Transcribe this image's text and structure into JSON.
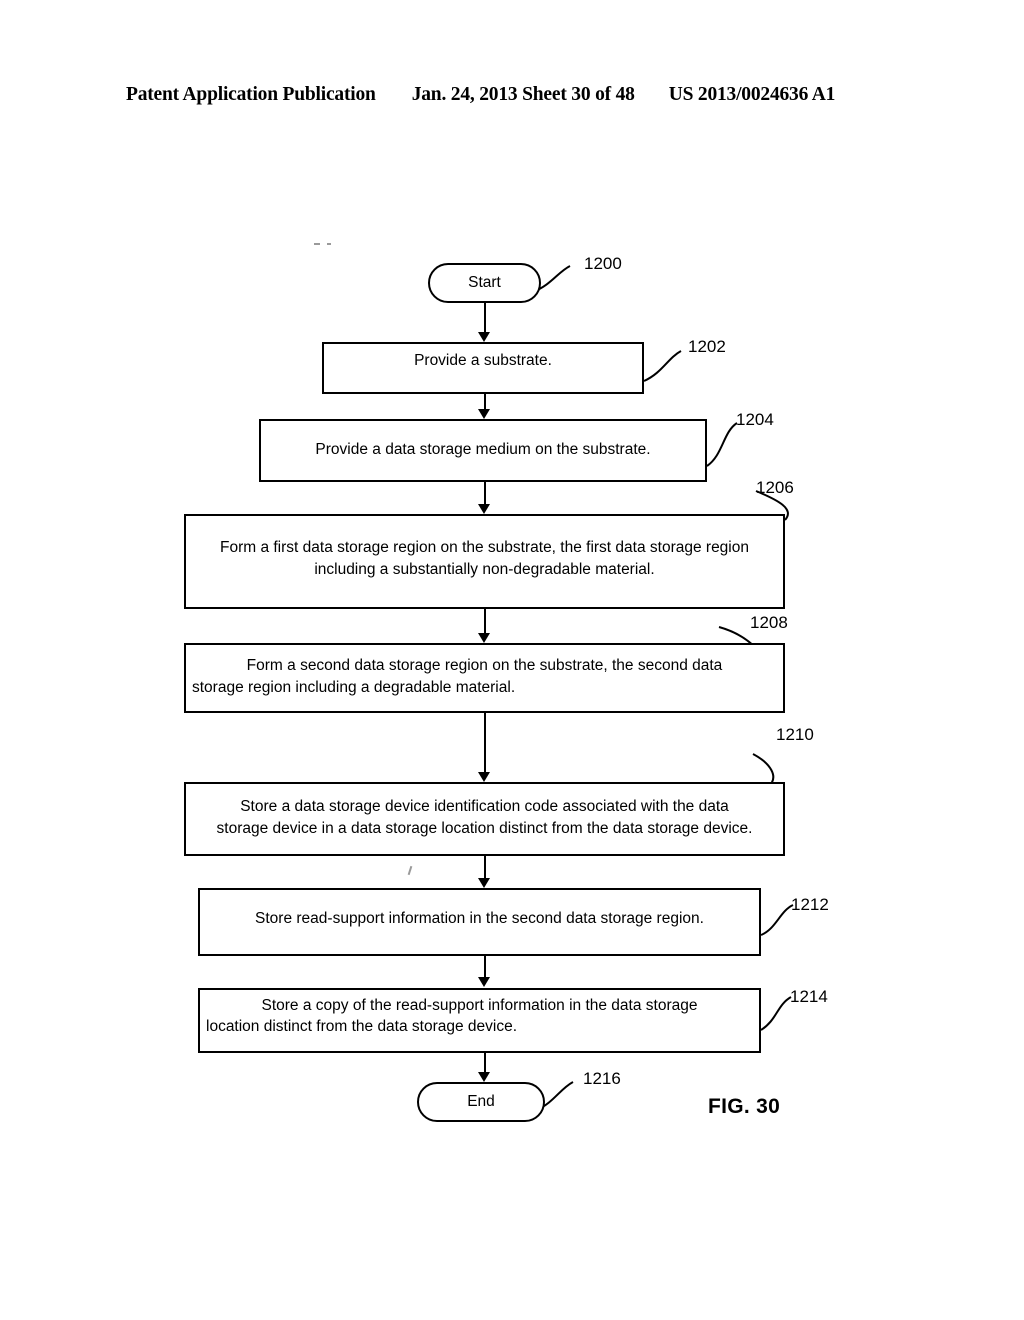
{
  "header": {
    "left": "Patent Application Publication",
    "middle": "Jan. 24, 2013  Sheet 30 of 48",
    "right": "US 2013/0024636 A1"
  },
  "figure": {
    "label": "FIG. 30"
  },
  "flowchart": {
    "start": {
      "label": "Start",
      "ref": "1200"
    },
    "end": {
      "label": "End",
      "ref": "1216"
    },
    "steps": [
      {
        "ref": "1202",
        "lines": [
          "Provide a substrate."
        ]
      },
      {
        "ref": "1204",
        "lines": [
          "Provide a data storage medium on the substrate."
        ]
      },
      {
        "ref": "1206",
        "lines": [
          "Form a first data storage region on the substrate, the first data storage region",
          "including a substantially non-degradable material."
        ]
      },
      {
        "ref": "1208",
        "lines": [
          "Form a second data storage region on the substrate, the second data",
          "storage region including a degradable material."
        ]
      },
      {
        "ref": "1210",
        "lines": [
          "Store a data storage device identification code associated with the data",
          "storage device in a data storage location distinct from the data storage device."
        ]
      },
      {
        "ref": "1212",
        "lines": [
          "Store read-support information in the second data storage region."
        ]
      },
      {
        "ref": "1214",
        "lines": [
          "Store a copy of the read-support information in the data storage",
          "location distinct from the data storage device."
        ]
      }
    ]
  }
}
